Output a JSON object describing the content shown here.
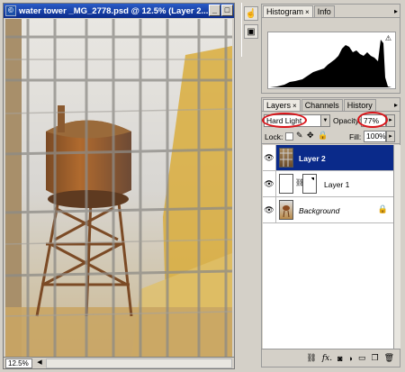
{
  "document": {
    "title": "water tower _MG_2778.psd @ 12.5% (Layer 2...",
    "zoom": "12.5%"
  },
  "histogram_panel": {
    "tabs": [
      {
        "label": "Histogram",
        "active": true
      },
      {
        "label": "Info",
        "active": false
      }
    ],
    "warning_glyph": "⚠"
  },
  "layers_panel": {
    "tabs": [
      {
        "label": "Layers",
        "active": true
      },
      {
        "label": "Channels",
        "active": false
      },
      {
        "label": "History",
        "active": false
      }
    ],
    "blend_mode": "Hard Light",
    "opacity_label": "Opacity:",
    "opacity_value": "77%",
    "lock_label": "Lock:",
    "fill_label": "Fill:",
    "fill_value": "100%",
    "layers": [
      {
        "name": "Layer 2",
        "selected": true,
        "visible": true
      },
      {
        "name": "Layer 1",
        "selected": false,
        "visible": true,
        "has_mask": true
      },
      {
        "name": "Background",
        "selected": false,
        "visible": true,
        "locked": true
      }
    ]
  },
  "colors": {
    "selection": "#0a2a8a",
    "annotation_red": "#d9141a",
    "chrome": "#d4d0c8"
  },
  "icons": {
    "eye": "eye-icon",
    "lock": "lock-icon",
    "chain": "chain-link-icon",
    "tool": "path-selection-icon"
  }
}
